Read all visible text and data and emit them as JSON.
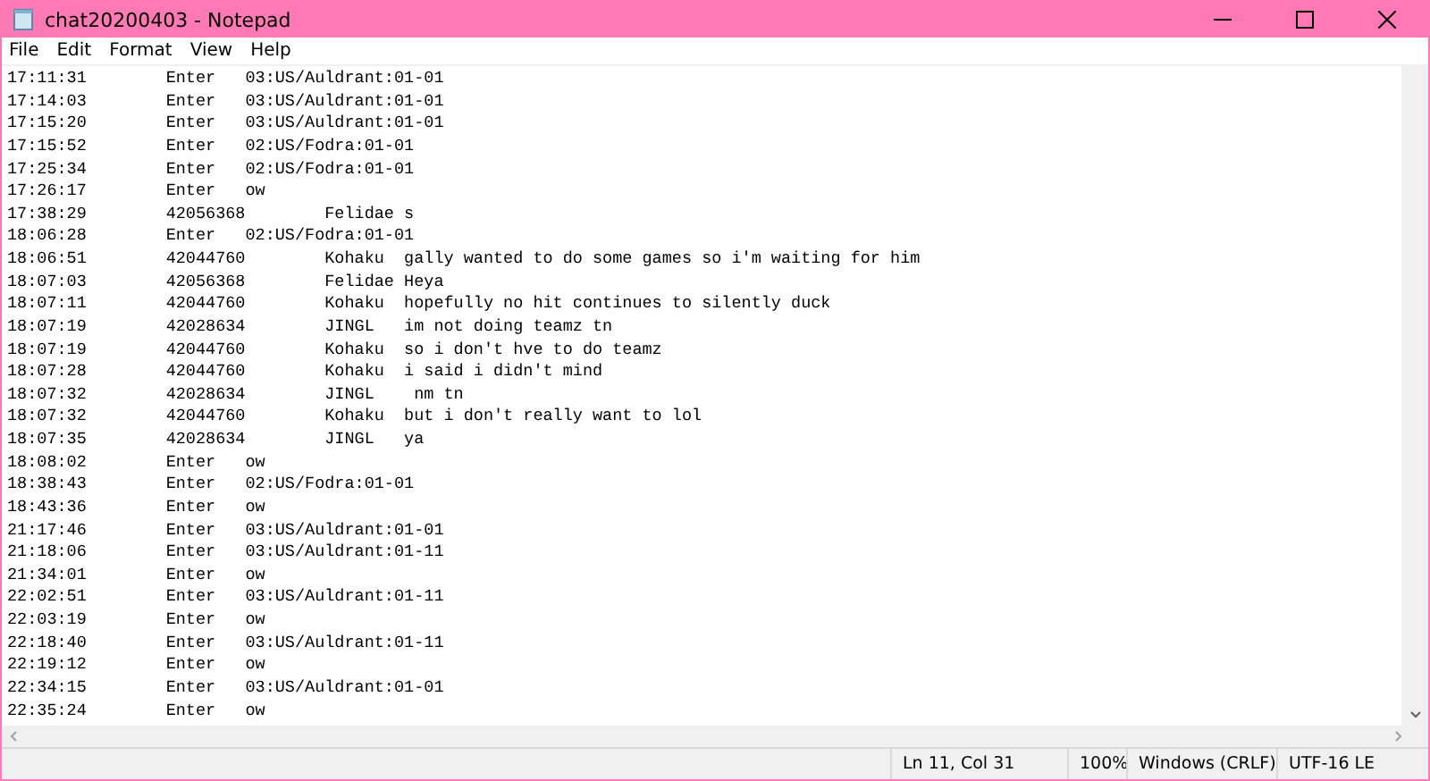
{
  "window": {
    "title": "chat20200403 - Notepad"
  },
  "menu": [
    {
      "label": "File"
    },
    {
      "label": "Edit"
    },
    {
      "label": "Format"
    },
    {
      "label": "View"
    },
    {
      "label": "Help"
    }
  ],
  "lines": [
    "17:11:31        Enter   03:US/Auldrant:01-01",
    "17:14:03        Enter   03:US/Auldrant:01-01",
    "17:15:20        Enter   03:US/Auldrant:01-01",
    "17:15:52        Enter   02:US/Fodra:01-01",
    "17:25:34        Enter   02:US/Fodra:01-01",
    "17:26:17        Enter   ow",
    "17:38:29        42056368        Felidae s",
    "18:06:28        Enter   02:US/Fodra:01-01",
    "18:06:51        42044760        Kohaku  gally wanted to do some games so i'm waiting for him",
    "18:07:03        42056368        Felidae Heya",
    "18:07:11        42044760        Kohaku  hopefully no hit continues to silently duck",
    "18:07:19        42028634        JINGL   im not doing teamz tn",
    "18:07:19        42044760        Kohaku  so i don't hve to do teamz",
    "18:07:28        42044760        Kohaku  i said i didn't mind",
    "18:07:32        42028634        JINGL    nm tn",
    "18:07:32        42044760        Kohaku  but i don't really want to lol",
    "18:07:35        42028634        JINGL   ya",
    "18:08:02        Enter   ow",
    "18:38:43        Enter   02:US/Fodra:01-01",
    "18:43:36        Enter   ow",
    "21:17:46        Enter   03:US/Auldrant:01-01",
    "21:18:06        Enter   03:US/Auldrant:01-11",
    "21:34:01        Enter   ow",
    "22:02:51        Enter   03:US/Auldrant:01-11",
    "22:03:19        Enter   ow",
    "22:18:40        Enter   03:US/Auldrant:01-11",
    "22:19:12        Enter   ow",
    "22:34:15        Enter   03:US/Auldrant:01-01",
    "22:35:24        Enter   ow"
  ],
  "status_bar": {
    "position": "Ln 11, Col 31",
    "zoom": "100%",
    "line_ending": "Windows (CRLF)",
    "encoding": "UTF-16 LE"
  }
}
